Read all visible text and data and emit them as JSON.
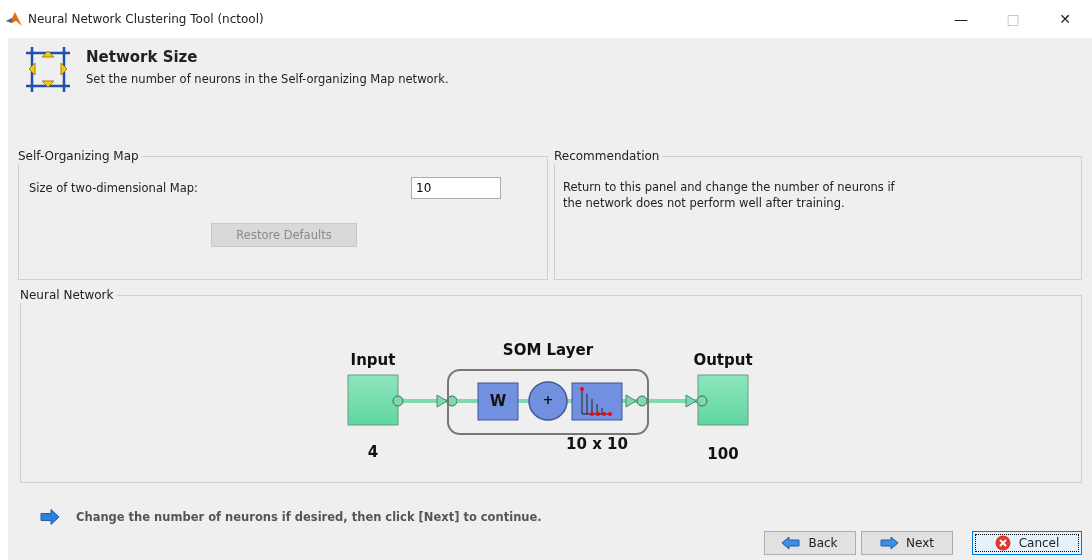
{
  "window": {
    "title": "Neural Network Clustering Tool (nctool)",
    "controls": [
      "—",
      "□",
      "✕"
    ]
  },
  "header": {
    "title": "Network Size",
    "subtitle": "Set the number of neurons in the Self-organizing Map network."
  },
  "som_panel": {
    "title": "Self-Organizing Map",
    "field_label": "Size of two-dimensional Map:",
    "value": "10",
    "restore_button": {
      "label": "Restore Defaults",
      "disabled": true
    }
  },
  "recommendation_panel": {
    "title": "Recommendation",
    "text": "Return to this panel and change the number of neurons if\nthe network does not perform well after training."
  },
  "network_panel": {
    "title": "Neural Network",
    "input_label": "Input",
    "input_size": "4",
    "layer_label": "SOM Layer",
    "layer_size": "10 x 10",
    "weight_label": "W",
    "sum_label": "+",
    "output_label": "Output",
    "output_size": "100"
  },
  "hint": "Change the number of neurons if desired, then click [Next] to continue.",
  "buttons": [
    {
      "label": "Back",
      "kind": "back",
      "focused": false
    },
    {
      "label": "Next",
      "kind": "next",
      "focused": false
    },
    {
      "label": "Cancel",
      "kind": "cancel",
      "focused": true
    }
  ]
}
